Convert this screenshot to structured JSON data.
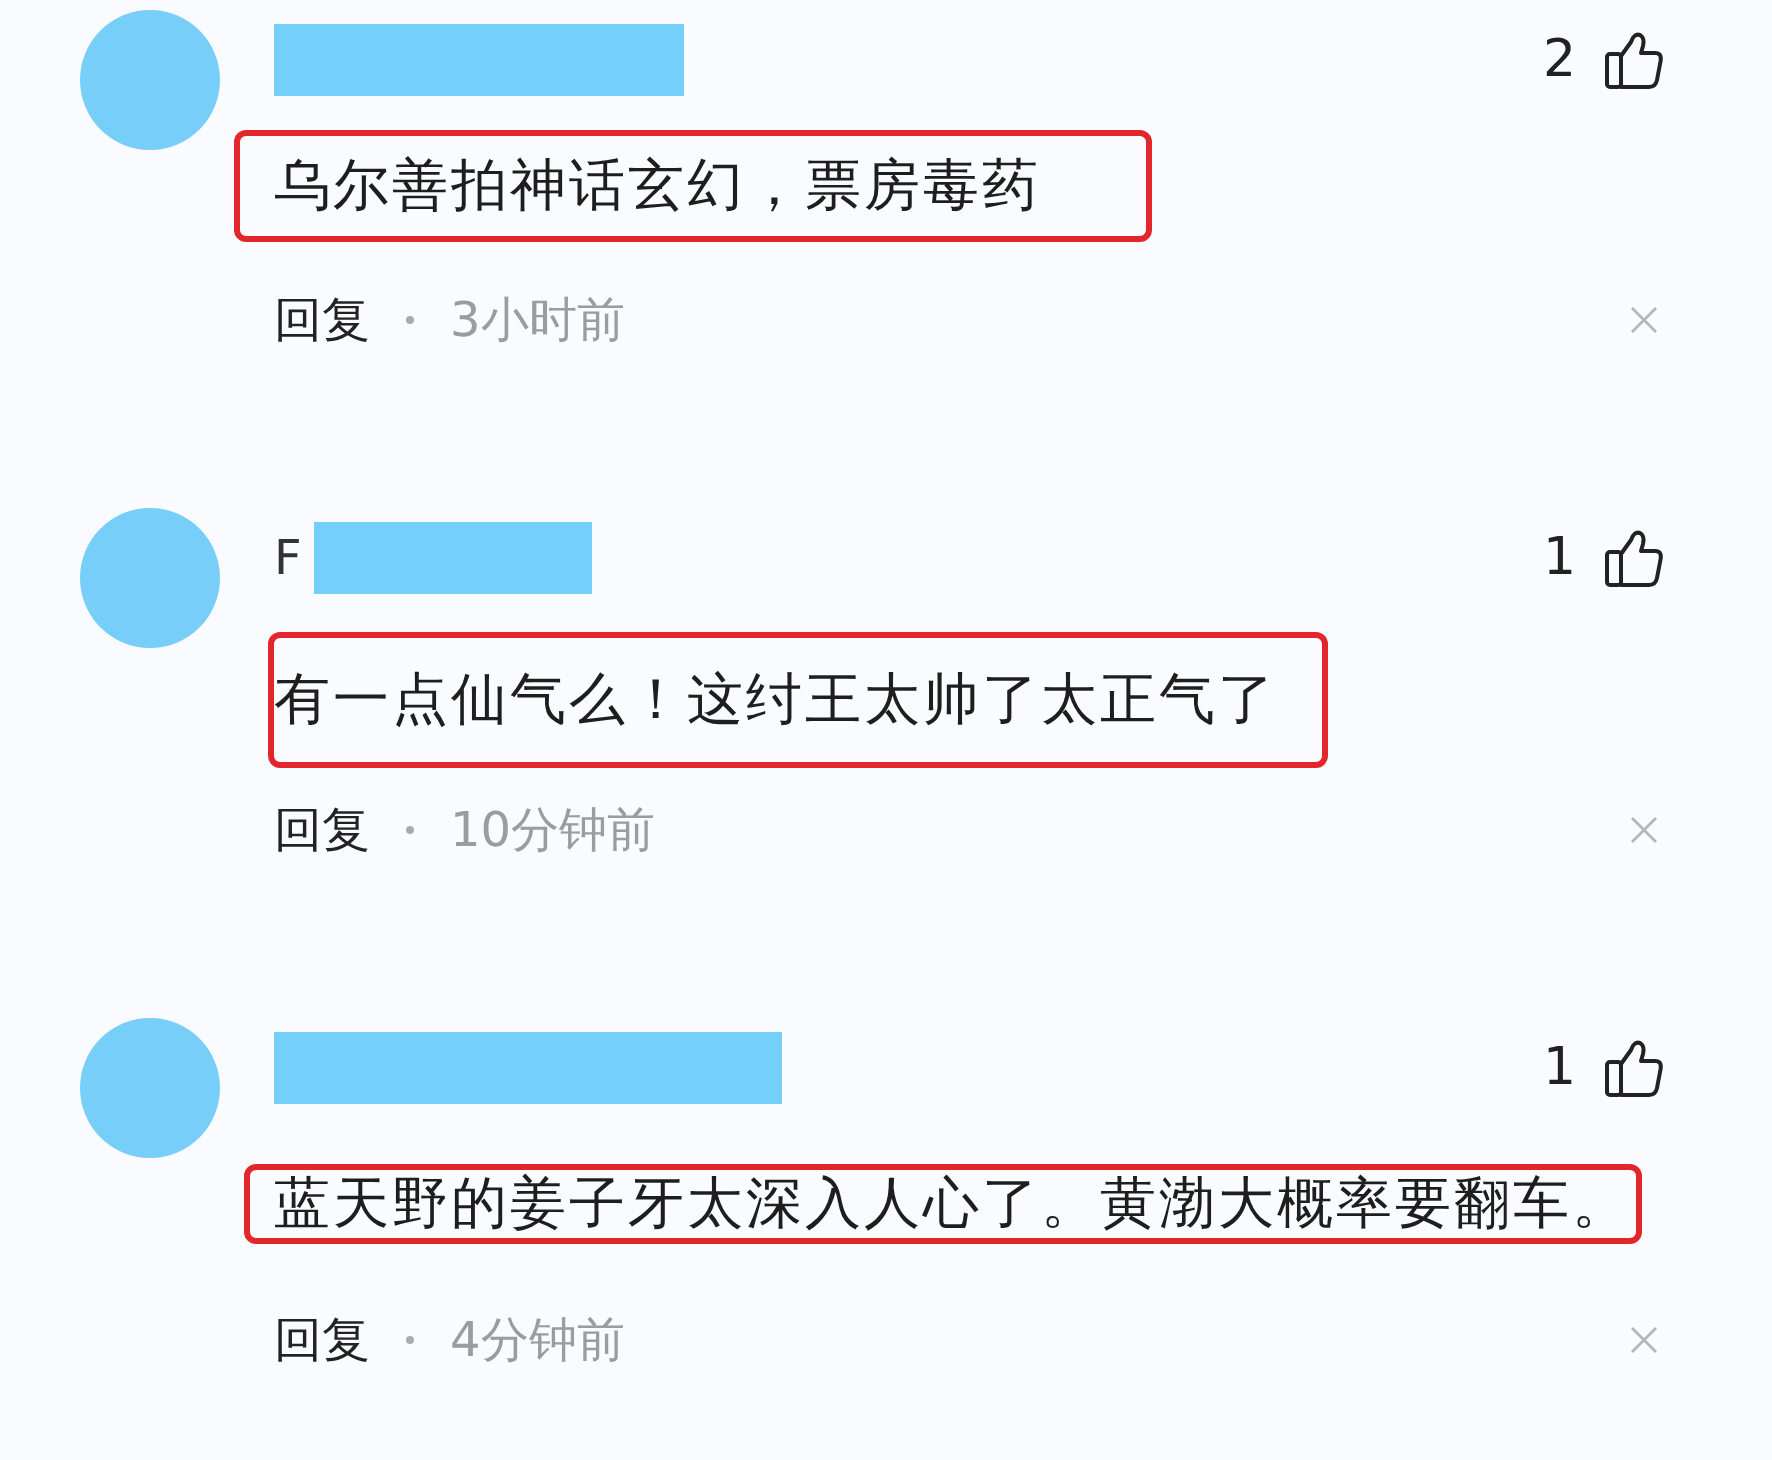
{
  "comments": [
    {
      "likes": "2",
      "text": "乌尔善拍神话玄幻，票房毒药",
      "highlighted": true,
      "reply": "回复",
      "time": "3小时前"
    },
    {
      "username": "F",
      "likes": "1",
      "text": "有一点仙气么！这纣王太帅了太正气了",
      "highlighted": true,
      "reply": "回复",
      "time": "10分钟前"
    },
    {
      "likes": "1",
      "text": "蓝天野的姜子牙太深入人心了。黄渤大概率要翻车。",
      "highlighted": true,
      "reply": "回复",
      "time": "4分钟前"
    }
  ]
}
